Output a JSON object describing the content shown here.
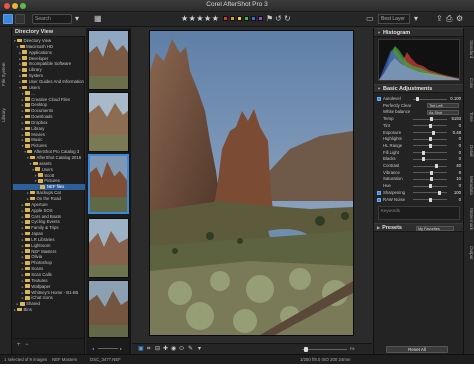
{
  "window": {
    "title": "Corel AfterShot Pro 3"
  },
  "toolbar": {
    "search_placeholder": "Search",
    "rating_stars": "★★★★★",
    "color_labels": [
      "#d63b3b",
      "#e6942a",
      "#e5d23a",
      "#4cb54a",
      "#3b6fd6",
      "#a545c9"
    ],
    "right_field": "Best Layer"
  },
  "left_tabs": [
    "File System",
    "Library"
  ],
  "directory": {
    "header": "Directory View",
    "items": [
      {
        "label": "Directory View",
        "depth": 0,
        "arrow": "▾"
      },
      {
        "label": "Macintosh HD",
        "depth": 1,
        "arrow": "▾"
      },
      {
        "label": "Applications",
        "depth": 2,
        "arrow": "▸"
      },
      {
        "label": "Developer",
        "depth": 2,
        "arrow": "▸"
      },
      {
        "label": "Incompatible Software",
        "depth": 2,
        "arrow": "▸"
      },
      {
        "label": "Library",
        "depth": 2,
        "arrow": "▸"
      },
      {
        "label": "System",
        "depth": 2,
        "arrow": "▸"
      },
      {
        "label": "User Guides And Information",
        "depth": 2,
        "arrow": "▸"
      },
      {
        "label": "Users",
        "depth": 2,
        "arrow": "▾"
      },
      {
        "label": "...",
        "depth": 3,
        "arrow": "▾"
      },
      {
        "label": "Creative Cloud Files",
        "depth": 3,
        "arrow": "▸"
      },
      {
        "label": "Desktop",
        "depth": 3,
        "arrow": "▸"
      },
      {
        "label": "Documents",
        "depth": 3,
        "arrow": "▸"
      },
      {
        "label": "Downloads",
        "depth": 3,
        "arrow": "▸"
      },
      {
        "label": "Dropbox",
        "depth": 3,
        "arrow": "▸"
      },
      {
        "label": "Library",
        "depth": 3,
        "arrow": "▸"
      },
      {
        "label": "Movies",
        "depth": 3,
        "arrow": "▸"
      },
      {
        "label": "Music",
        "depth": 3,
        "arrow": "▸"
      },
      {
        "label": "Pictures",
        "depth": 3,
        "arrow": "▾"
      },
      {
        "label": "AfterShot Pro Catalog 3",
        "depth": 4,
        "arrow": "▾"
      },
      {
        "label": "AfterShot Catalog 2016",
        "depth": 5,
        "arrow": "▾"
      },
      {
        "label": "assets",
        "depth": 6,
        "arrow": "▾"
      },
      {
        "label": "Users",
        "depth": 7,
        "arrow": "▾"
      },
      {
        "label": "Scott",
        "depth": 8,
        "arrow": "▾"
      },
      {
        "label": "Pictures",
        "depth": 8,
        "arrow": "▾"
      },
      {
        "label": "NEF files",
        "depth": 9,
        "arrow": "",
        "selected": true
      },
      {
        "label": "Backups Cat",
        "depth": 5,
        "arrow": "▸"
      },
      {
        "label": "On the Road",
        "depth": 5,
        "arrow": "▸"
      },
      {
        "label": "Aperture",
        "depth": 3,
        "arrow": "▸"
      },
      {
        "label": "Apple SOS",
        "depth": 3,
        "arrow": "▸"
      },
      {
        "label": "Cars and Boats",
        "depth": 3,
        "arrow": "▸"
      },
      {
        "label": "Cycling Events",
        "depth": 3,
        "arrow": "▸"
      },
      {
        "label": "Family & Trips",
        "depth": 3,
        "arrow": "▸"
      },
      {
        "label": "Japan",
        "depth": 3,
        "arrow": "▸"
      },
      {
        "label": "LR Libraries",
        "depth": 3,
        "arrow": "▸"
      },
      {
        "label": "Lightroom",
        "depth": 3,
        "arrow": "▸"
      },
      {
        "label": "NEF Masters",
        "depth": 3,
        "arrow": "▸"
      },
      {
        "label": "Olivia",
        "depth": 3,
        "arrow": "▸"
      },
      {
        "label": "Photoshop",
        "depth": 3,
        "arrow": "▸"
      },
      {
        "label": "Scans",
        "depth": 3,
        "arrow": "▸"
      },
      {
        "label": "Scan Calls",
        "depth": 3,
        "arrow": "▸"
      },
      {
        "label": "Textures",
        "depth": 3,
        "arrow": "▸"
      },
      {
        "label": "Wallpaper",
        "depth": 3,
        "arrow": "▸"
      },
      {
        "label": "Whitney's Home - B1-B5",
        "depth": 3,
        "arrow": "▸"
      },
      {
        "label": "iChat Icons",
        "depth": 3,
        "arrow": "▸"
      },
      {
        "label": "Shared",
        "depth": 1,
        "arrow": "▸"
      },
      {
        "label": "Bins",
        "depth": 0,
        "arrow": "▸"
      }
    ]
  },
  "viewer": {
    "zoom": "Fit"
  },
  "right_tabs": [
    "Standard",
    "Color",
    "Tone",
    "Detail",
    "Metadata",
    "Watermark",
    "Output"
  ],
  "histogram": {
    "header": "Histogram"
  },
  "basic_adjustments": {
    "header": "Basic Adjustments",
    "rows": [
      {
        "label": "Autolevel",
        "value": "0.100",
        "type": "slider",
        "pos": 0.1
      },
      {
        "label": "Perfectly Clear",
        "value": "",
        "type": "dropdown",
        "option": "Tint Left"
      },
      {
        "label": "White balance",
        "value": "",
        "type": "dropdown",
        "option": "As Shot"
      },
      {
        "label": "Temp",
        "value": "5193",
        "type": "slider",
        "pos": 0.55
      },
      {
        "label": "Tint",
        "value": "0",
        "type": "slider",
        "pos": 0.5
      },
      {
        "label": "Exposure",
        "value": "0.48",
        "type": "slider",
        "pos": 0.6
      },
      {
        "label": "Highlights",
        "value": "0",
        "type": "slider",
        "pos": 0.5
      },
      {
        "label": "HL Range",
        "value": "0",
        "type": "slider",
        "pos": 0.5
      },
      {
        "label": "Fill Light",
        "value": "0",
        "type": "slider",
        "pos": 0.3
      },
      {
        "label": "Blacks",
        "value": "0",
        "type": "slider",
        "pos": 0.3
      },
      {
        "label": "Contrast",
        "value": "40",
        "type": "slider",
        "pos": 0.7
      },
      {
        "label": "Vibrance",
        "value": "8",
        "type": "slider",
        "pos": 0.55
      },
      {
        "label": "Saturation",
        "value": "10",
        "type": "slider",
        "pos": 0.55
      },
      {
        "label": "Hue",
        "value": "0",
        "type": "slider",
        "pos": 0.5
      },
      {
        "label": "Sharpening",
        "value": "100",
        "type": "check",
        "pos": 0.8
      },
      {
        "label": "RAW Noise",
        "value": "0",
        "type": "check",
        "pos": 0.5
      }
    ],
    "keywords_placeholder": "Keywords"
  },
  "presets": {
    "header": "Presets",
    "option": "My Favorites"
  },
  "reset_label": "Reset All",
  "status": {
    "selection": "1 selected of 9 images",
    "path": "NEF Masters",
    "filename": "DSC_3477.NEF",
    "info": "1/250  f/8.0  ISO 200  24mm"
  }
}
